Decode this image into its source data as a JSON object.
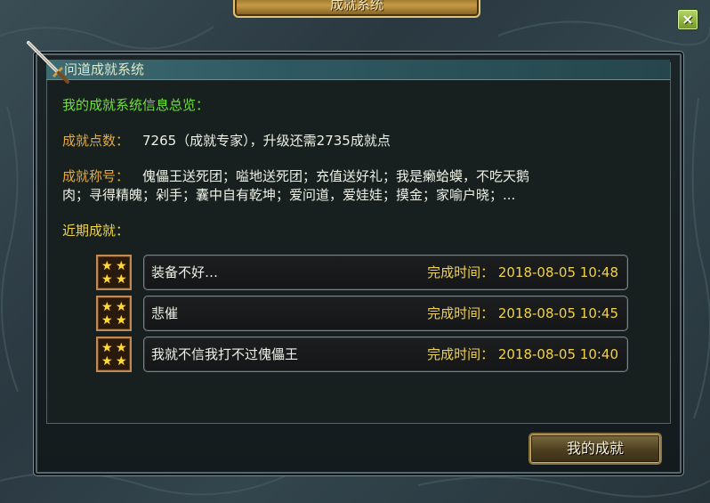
{
  "window": {
    "title": "成就系统",
    "close_glyph": "×"
  },
  "panel": {
    "section_title": "问道成就系统",
    "overview_heading": "我的成就系统信息总览：",
    "points_label": "成就点数：",
    "points_value": "7265（成就专家），升级还需2735成就点",
    "titles_label": "成就称号：",
    "titles_line1": "傀儡王送死团；嗌地送死团；充值送好礼；我是癞蛤蟆，不吃天鹅",
    "titles_line2": "肉；寻得精魄；剁手；囊中自有乾坤；爱问道，爱娃娃；摸金；家喻户晓；...",
    "recent_label": "近期成就："
  },
  "achievements": [
    {
      "name": "装备不好…",
      "time": "完成时间：  2018-08-05 10:48",
      "icon": "three-star-icon"
    },
    {
      "name": "悲催",
      "time": "完成时间：  2018-08-05 10:45",
      "icon": "three-star-icon"
    },
    {
      "name": "我就不信我打不过傀儡王",
      "time": "完成时间：  2018-08-05 10:40",
      "icon": "three-star-icon"
    }
  ],
  "buttons": {
    "my_achievements": "我的成就"
  },
  "colors": {
    "heading_green": "#6ee039",
    "label_yellow": "#f0d24a",
    "text_white": "#eef0e6"
  }
}
